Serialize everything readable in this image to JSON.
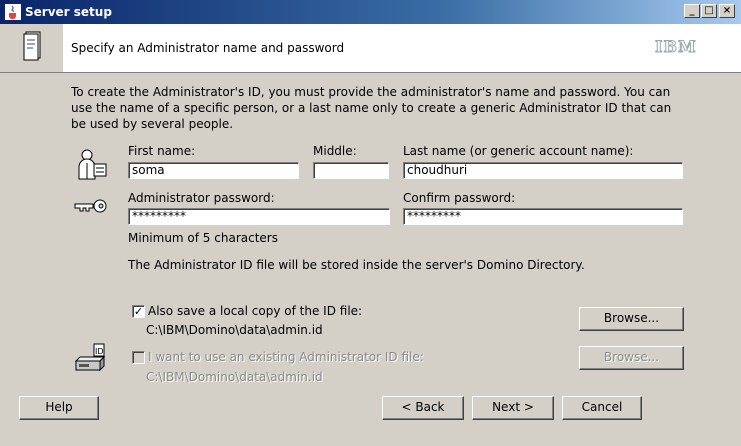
{
  "window": {
    "title": "Server setup"
  },
  "header": {
    "title": "Specify an Administrator name and password",
    "logo": "IBM"
  },
  "intro": "To create the Administrator's ID, you must provide the administrator's name and password. You can use the name of a specific person, or a last name only to create a generic Administrator ID that can be used by several people.",
  "name_fields": {
    "first_label": "First name:",
    "first_value": "soma",
    "middle_label": "Middle:",
    "middle_value": "",
    "last_label": "Last name (or generic account name):",
    "last_value": "choudhuri"
  },
  "password_fields": {
    "password_label": "Administrator password:",
    "password_value": "*********",
    "confirm_label": "Confirm password:",
    "confirm_value": "*********",
    "hint": "Minimum of 5 characters"
  },
  "storage_note": "The Administrator ID file will be stored inside the server's Domino Directory.",
  "local_copy": {
    "label": "Also save a local copy of the ID file:",
    "checked": true,
    "path": "C:\\IBM\\Domino\\data\\admin.id",
    "browse_label": "Browse..."
  },
  "existing_id": {
    "label": "I want to use an existing Administrator ID file:",
    "checked": false,
    "path": "C:\\IBM\\Domino\\data\\admin.id",
    "browse_label": "Browse..."
  },
  "buttons": {
    "help": "Help",
    "back": "< Back",
    "next": "Next >",
    "cancel": "Cancel"
  },
  "icons": {
    "app": "java-cup-icon",
    "header": "document-icon",
    "person": "person-id-icon",
    "key": "key-icon",
    "id_file": "id-file-icon"
  },
  "colors": {
    "titlebar": "#0a246a",
    "dialog": "#d4d0c8"
  }
}
